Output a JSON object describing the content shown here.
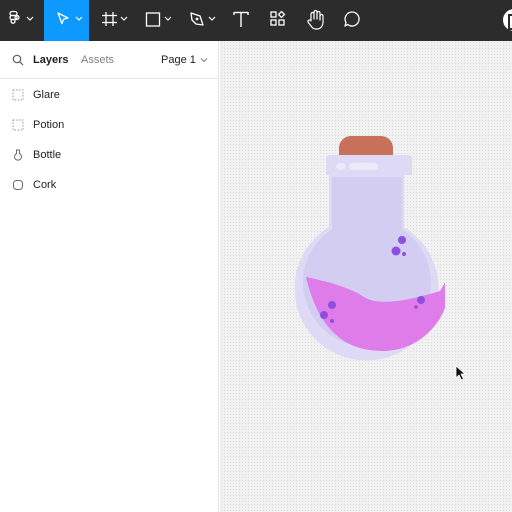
{
  "toolbar": {
    "tools": [
      {
        "name": "main-menu",
        "icon": "figma-logo-icon"
      },
      {
        "name": "move-tool",
        "icon": "pointer-icon",
        "active": true
      },
      {
        "name": "frame-tool",
        "icon": "hash-frame-icon"
      },
      {
        "name": "shape-tool",
        "icon": "rectangle-icon"
      },
      {
        "name": "pen-tool",
        "icon": "pen-icon"
      },
      {
        "name": "text-tool",
        "icon": "text-icon"
      },
      {
        "name": "resources-tool",
        "icon": "components-icon"
      },
      {
        "name": "hand-tool",
        "icon": "hand-icon"
      },
      {
        "name": "comment-tool",
        "icon": "comment-icon"
      }
    ],
    "active_color": "#0d99ff",
    "background": "#2c2c2c"
  },
  "sidebar": {
    "tabs": {
      "layers": "Layers",
      "assets": "Assets"
    },
    "page": "Page 1",
    "layers": [
      {
        "label": "Glare",
        "icon": "dashed-frame-icon"
      },
      {
        "label": "Potion",
        "icon": "dashed-frame-icon"
      },
      {
        "label": "Bottle",
        "icon": "bottle-shape-icon"
      },
      {
        "label": "Cork",
        "icon": "rounded-rect-icon"
      }
    ]
  },
  "canvas": {
    "artwork": "potion-bottle",
    "colors": {
      "cork": "#c8715a",
      "bottle_outer": "#ded9f5",
      "bottle_inner": "#d3cdf2",
      "potion": "#de7ce9",
      "bubbles": "#8e4ee0",
      "glare": "#ece9f9"
    }
  }
}
